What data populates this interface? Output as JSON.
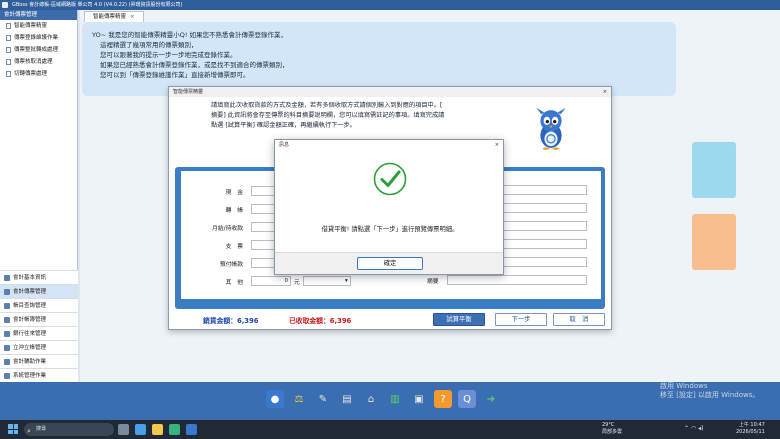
{
  "window": {
    "title": "GBoss 會計總帳-區域網路版 單公司 4.0 (V4.0.22) (昇環資訊股份有限公司)"
  },
  "sidebar": {
    "header": "會計傳票管理",
    "tree_items": [
      {
        "label": "智能傳票精靈"
      },
      {
        "label": "傳票登錄維護作業"
      },
      {
        "label": "傳票整批轉成處理"
      },
      {
        "label": "傳票核取消處理"
      },
      {
        "label": "切轉傳票處理"
      }
    ],
    "menu_items": [
      {
        "label": "會計基本資訊"
      },
      {
        "label": "會計傳票管理"
      },
      {
        "label": "帳目查詢管理"
      },
      {
        "label": "會計帳簿管理"
      },
      {
        "label": "銀行往來管理"
      },
      {
        "label": "立沖立帳管理"
      },
      {
        "label": "會計輔助作業"
      },
      {
        "label": "系統管理作業"
      }
    ]
  },
  "main": {
    "tab_label": "智能傳票精靈",
    "tab_close": "×",
    "guide_lines": [
      "YO~ 我是您的智能傳票精靈小Q! 如果您不熟悉會計傳票登錄作業，",
      "這裡精選了幾項常用的傳票類別，",
      "您可以跟著我的提示一步一步地完成登錄作業。",
      "如果您已經熟悉會計傳票登錄作業，或是找不到適合的傳票類別，",
      "您可以到「傳票登錄維護作業」直接新增傳票即可。"
    ]
  },
  "wizard": {
    "title": "智能傳票精靈",
    "close": "×",
    "instruction_lines": [
      "請填寫此次收取貨款的方式及金額，若有多個收取方式請個別輸入到對應的項目中。[",
      "摘要] 此資訊將會存至傳票的科目摘要說明欄，您可以填寫需註記的事項。填寫完成請",
      "點選 [試算平衡] 確認金額正確，再繼續執行下一步。"
    ],
    "form": {
      "rows": [
        {
          "label": "現　金"
        },
        {
          "label": "轉　帳"
        },
        {
          "label": "月結/待收款"
        },
        {
          "label": "支　票"
        },
        {
          "label": "預付帳款"
        }
      ],
      "other_label": "其　他",
      "other_value": "0",
      "other_unit": "元",
      "summary_label": "摘要"
    },
    "debit_total": "銷貨金額：6,396",
    "credit_total": "已收取金額：6,396",
    "btn_balance": "試算平衡",
    "btn_next": "下一步",
    "btn_cancel": "取　消"
  },
  "message_box": {
    "title": "訊息",
    "close": "×",
    "text": "借貸平衡! 請點選「下一步」進行預覽傳票明細。",
    "ok_label": "確定"
  },
  "dock": {
    "watermark_line1": "啟用 Windows",
    "watermark_line2": "移至 [設定] 以啟用 Windows。"
  },
  "taskbar": {
    "search_placeholder": "搜尋",
    "weather_temp": "29°C",
    "weather_desc": "局部多雲",
    "time": "上午 10:47",
    "date": "2026/05/11"
  },
  "colors": {
    "titlebar": "#2f5e9c",
    "dock": "#3a6eb0",
    "primary_button": "#3d6fb5",
    "debit_text": "#1e48a8",
    "credit_text": "#c81818",
    "success_check": "#2e9e3a"
  }
}
